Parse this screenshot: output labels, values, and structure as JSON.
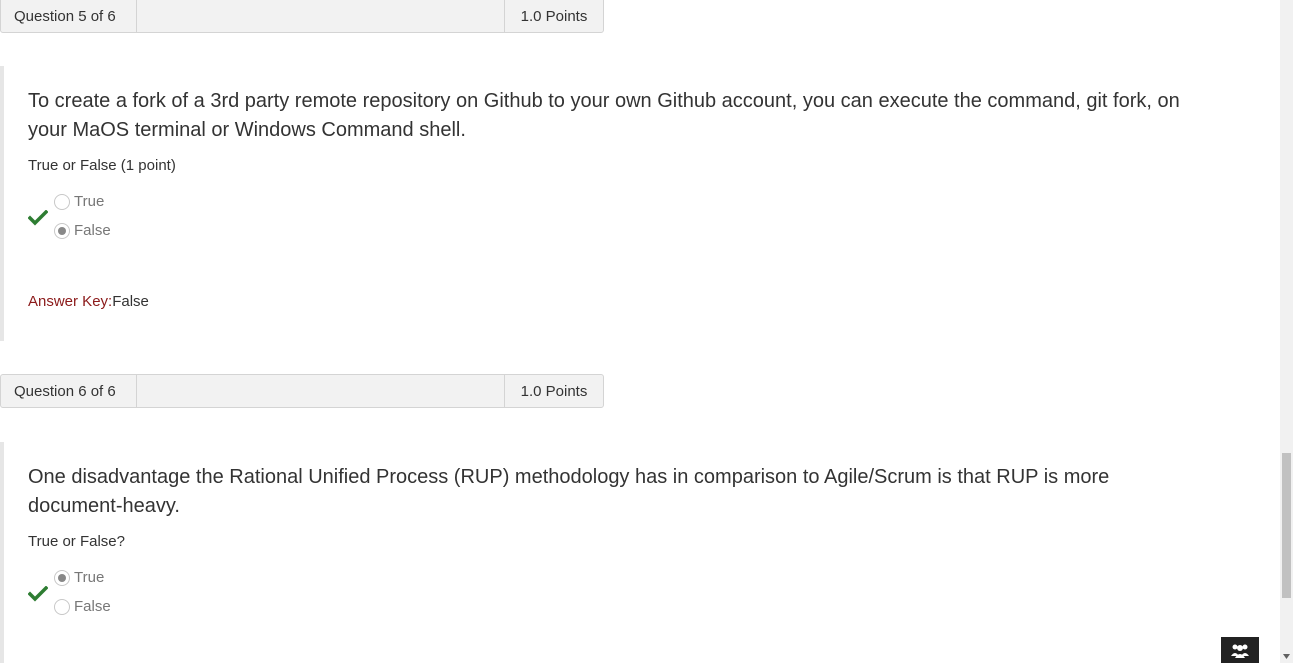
{
  "questions": [
    {
      "header": {
        "label": "Question 5 of 6",
        "points": "1.0 Points"
      },
      "text": "To create a fork of a 3rd party remote repository on Github to your own Github account, you can execute the command, git fork, on your MaOS terminal or Windows Command shell.",
      "type_label": "True or False (1 point)",
      "options": [
        {
          "label": "True",
          "selected": false
        },
        {
          "label": "False",
          "selected": true
        }
      ],
      "result_icon": "checkmark-icon",
      "answer_key": {
        "label": "Answer Key:",
        "value": "False"
      }
    },
    {
      "header": {
        "label": "Question 6 of 6",
        "points": "1.0 Points"
      },
      "text": "One disadvantage the Rational Unified Process (RUP) methodology has in comparison to Agile/Scrum is that RUP is more document-heavy.",
      "type_label": "True or False?",
      "options": [
        {
          "label": "True",
          "selected": true
        },
        {
          "label": "False",
          "selected": false
        }
      ],
      "result_icon": "checkmark-icon"
    }
  ],
  "colors": {
    "check": "#2e7d32",
    "answer_key_label": "#8b1a1a",
    "header_bg": "#f2f2f2"
  },
  "help_icon": "people-icon"
}
